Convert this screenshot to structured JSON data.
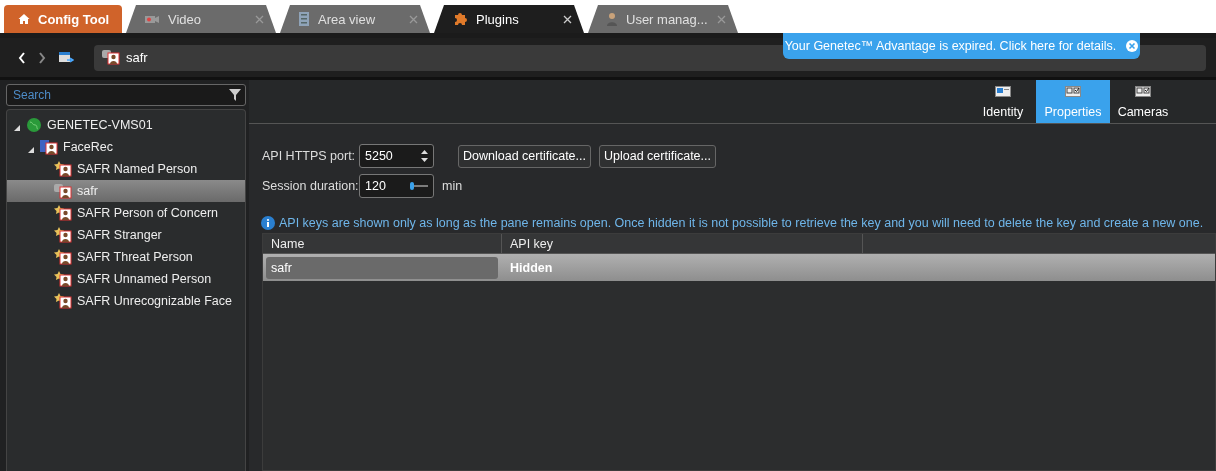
{
  "tabs": [
    {
      "kind": "home",
      "label": "Config Tool"
    },
    {
      "kind": "video",
      "label": "Video",
      "selected": false
    },
    {
      "kind": "building",
      "label": "Area view",
      "selected": false
    },
    {
      "kind": "puzzle",
      "label": "Plugins",
      "selected": true
    },
    {
      "kind": "user",
      "label": "User manag...",
      "selected": false
    }
  ],
  "address": {
    "entity": "safr"
  },
  "notification": {
    "text": "Your Genetec™ Advantage is expired. Click here for details."
  },
  "sidebar": {
    "search": {
      "placeholder": "Search"
    },
    "tree": [
      {
        "label": "GENETEC-VMS01",
        "kind": "server",
        "expanded": true,
        "selected": false,
        "children": [
          {
            "label": "FaceRec",
            "kind": "role",
            "expanded": true,
            "selected": false,
            "children": [
              {
                "label": "SAFR Named Person",
                "kind": "alarm",
                "selected": false
              },
              {
                "label": "safr",
                "kind": "user",
                "selected": true
              },
              {
                "label": "SAFR Person of Concern",
                "kind": "alarm",
                "selected": false
              },
              {
                "label": "SAFR Stranger",
                "kind": "alarm",
                "selected": false
              },
              {
                "label": "SAFR Threat Person",
                "kind": "alarm",
                "selected": false
              },
              {
                "label": "SAFR Unnamed Person",
                "kind": "alarm",
                "selected": false
              },
              {
                "label": "SAFR Unrecognizable Face",
                "kind": "alarm",
                "selected": false
              }
            ]
          }
        ]
      }
    ]
  },
  "view_tabs": [
    {
      "label": "Identity",
      "kind": "identity",
      "selected": false
    },
    {
      "label": "Properties",
      "kind": "properties",
      "selected": true
    },
    {
      "label": "Cameras",
      "kind": "properties",
      "selected": false
    }
  ],
  "form": {
    "port_label": "API HTTPS port:",
    "port": "5250",
    "download": "Download certificate...",
    "upload": "Upload certificate...",
    "session_label": "Session duration:",
    "session": "120",
    "session_unit": "min"
  },
  "info": "API keys are shown only as long as the pane remains open. Once hidden it is not possible to retrieve the key and you will need to delete the key and create a new one.",
  "table": {
    "columns": [
      "Name",
      "API key"
    ],
    "rows": [
      {
        "name": "safr",
        "api_key": "Hidden",
        "selected": true
      }
    ]
  }
}
